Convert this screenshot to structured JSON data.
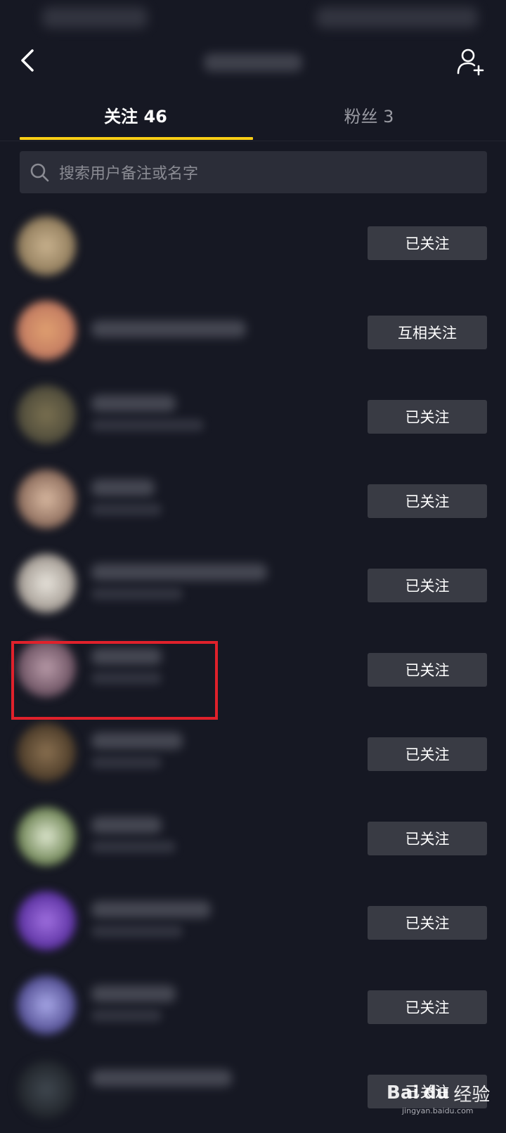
{
  "tabs": [
    {
      "label": "关注 46",
      "active": true
    },
    {
      "label": "粉丝 3",
      "active": false
    }
  ],
  "search": {
    "placeholder": "搜索用户备注或名字"
  },
  "colors": {
    "background": "#161823",
    "tab_indicator": "#face15",
    "button_bg": "#393b44",
    "highlight": "#e0212b"
  },
  "icons": {
    "back": "chevron-left-icon",
    "add_friend": "add-user-icon",
    "search": "search-icon"
  },
  "list": [
    {
      "follow_label": "已关注"
    },
    {
      "follow_label": "互相关注"
    },
    {
      "follow_label": "已关注"
    },
    {
      "follow_label": "已关注"
    },
    {
      "follow_label": "已关注"
    },
    {
      "follow_label": "已关注",
      "highlighted": true
    },
    {
      "follow_label": "已关注"
    },
    {
      "follow_label": "已关注"
    },
    {
      "follow_label": "已关注"
    },
    {
      "follow_label": "已关注"
    },
    {
      "follow_label": "已关注"
    }
  ],
  "watermark": {
    "logo": "Bai",
    "paw": "du",
    "brand": "经验",
    "url": "jingyan.baidu.com"
  }
}
